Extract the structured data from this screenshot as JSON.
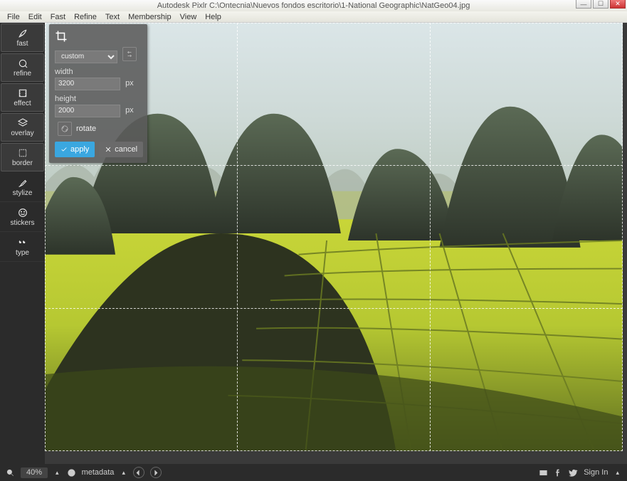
{
  "titlebar": {
    "title": "Autodesk Pixlr   C:\\Ontecnia\\Nuevos fondos escritorio\\1-National Geographic\\NatGeo04.jpg"
  },
  "menubar": [
    "File",
    "Edit",
    "Fast",
    "Refine",
    "Text",
    "Membership",
    "View",
    "Help"
  ],
  "sidebar": {
    "tools": [
      {
        "id": "fast",
        "label": "fast"
      },
      {
        "id": "refine",
        "label": "refine"
      },
      {
        "id": "effect",
        "label": "effect"
      },
      {
        "id": "overlay",
        "label": "overlay"
      },
      {
        "id": "border",
        "label": "border"
      },
      {
        "id": "stylize",
        "label": "stylize"
      },
      {
        "id": "stickers",
        "label": "stickers"
      },
      {
        "id": "type",
        "label": "type"
      }
    ]
  },
  "crop_panel": {
    "preset": "custom",
    "width_label": "width",
    "width_value": "3200",
    "height_label": "height",
    "height_value": "2000",
    "unit": "px",
    "rotate_label": "rotate",
    "apply_label": "apply",
    "cancel_label": "cancel"
  },
  "statusbar": {
    "zoom": "40%",
    "metadata_label": "metadata",
    "signin_label": "Sign In"
  }
}
